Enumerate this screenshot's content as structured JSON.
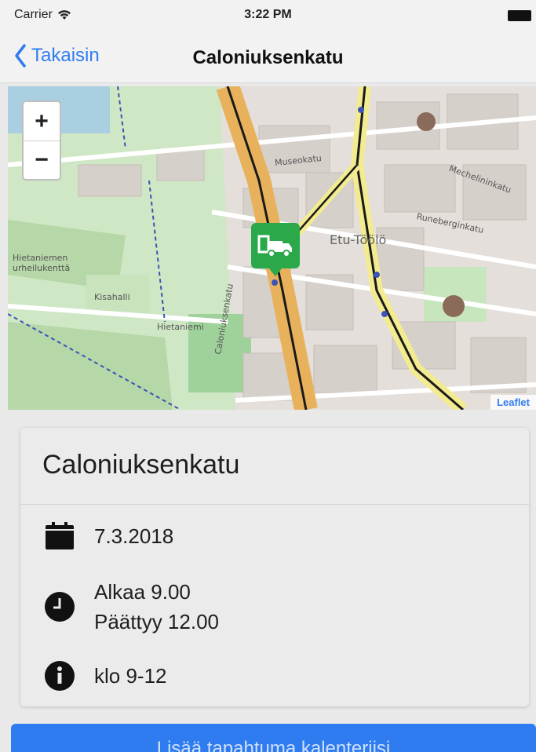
{
  "status_bar": {
    "carrier": "Carrier",
    "time": "3:22 PM"
  },
  "nav": {
    "back_label": "Takaisin",
    "title": "Caloniuksenkatu"
  },
  "map": {
    "zoom_in": "+",
    "zoom_out": "−",
    "district_label": "Etu-Töölö",
    "street_labels": [
      "Museokatu",
      "Mechelininkatu",
      "Runeberginkatu",
      "Caloniuksenkatu"
    ],
    "area_labels": [
      "Hietaniemen urheilukenttä",
      "Kisahalli",
      "Hietaniemi"
    ],
    "attribution_link": "Leaflet"
  },
  "event": {
    "name": "Caloniuksenkatu",
    "date": "7.3.2018",
    "start": "Alkaa 9.00",
    "end": "Päättyy 12.00",
    "info": "klo 9-12"
  },
  "calendar_button": "Lisää tapahtuma kalenteriisi",
  "colors": {
    "accent": "#2f7cf0",
    "marker": "#2aa84a"
  }
}
